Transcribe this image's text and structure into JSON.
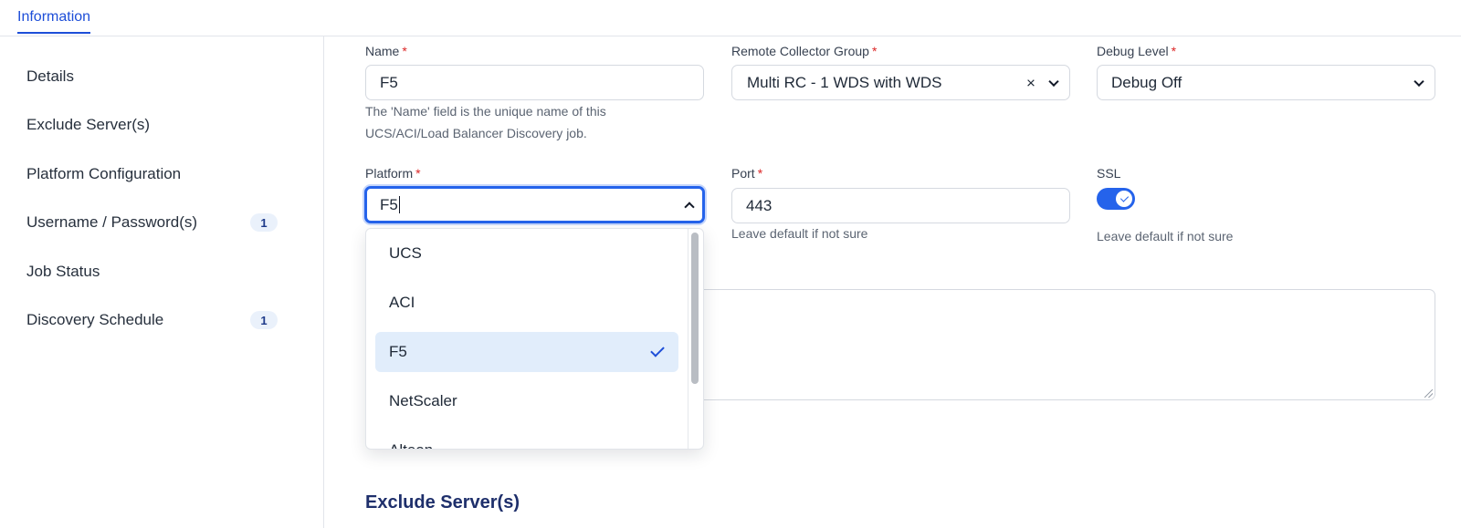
{
  "tabs": [
    {
      "label": "Information"
    }
  ],
  "sidebar": {
    "items": [
      {
        "label": "Details"
      },
      {
        "label": "Exclude Server(s)"
      },
      {
        "label": "Platform Configuration"
      },
      {
        "label": "Username / Password(s)",
        "badge": "1"
      },
      {
        "label": "Job Status"
      },
      {
        "label": "Discovery Schedule",
        "badge": "1"
      }
    ]
  },
  "form": {
    "required_mark": "*",
    "name": {
      "label": "Name",
      "value": "F5",
      "hint": "The 'Name' field is the unique name of this UCS/ACI/Load Balancer Discovery job."
    },
    "remote_collector_group": {
      "label": "Remote Collector Group",
      "value": "Multi RC - 1 WDS with WDS",
      "clear_symbol": "×"
    },
    "debug_level": {
      "label": "Debug Level",
      "value": "Debug Off"
    },
    "platform": {
      "label": "Platform",
      "value": "F5",
      "expanded": true,
      "options": [
        {
          "label": "UCS",
          "selected": false
        },
        {
          "label": "ACI",
          "selected": false
        },
        {
          "label": "F5",
          "selected": true
        },
        {
          "label": "NetScaler",
          "selected": false
        },
        {
          "label": "Alteon",
          "selected": false
        }
      ]
    },
    "port": {
      "label": "Port",
      "value": "443",
      "hint": "Leave default if not sure"
    },
    "ssl": {
      "label": "SSL",
      "enabled": true,
      "hint": "Leave default if not sure"
    }
  },
  "sections": {
    "exclude_servers_title": "Exclude Server(s)"
  },
  "colors": {
    "accent": "#2563eb",
    "tab_active": "#1d4ed8",
    "required": "#dc2626",
    "selected_option_bg": "#e1edfb",
    "section_title": "#1e2f6b"
  }
}
